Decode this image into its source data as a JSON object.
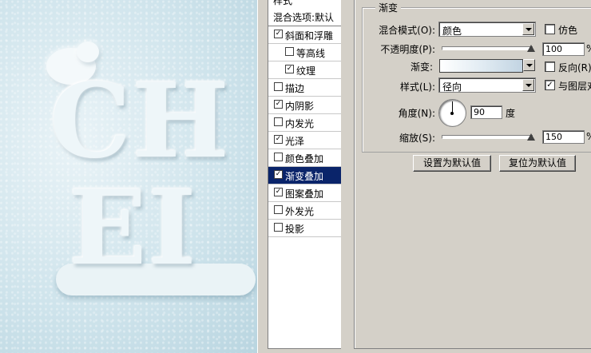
{
  "canvas": {
    "text_line1": "CH",
    "text_line2": "EI"
  },
  "styles_panel": {
    "clipped_header": "样式",
    "blending_options": "混合选项:默认",
    "items": [
      {
        "label": "斜面和浮雕",
        "checked": true,
        "indent": false,
        "selected": false
      },
      {
        "label": "等高线",
        "checked": false,
        "indent": true,
        "selected": false
      },
      {
        "label": "纹理",
        "checked": true,
        "indent": true,
        "selected": false
      },
      {
        "label": "描边",
        "checked": false,
        "indent": false,
        "selected": false
      },
      {
        "label": "内阴影",
        "checked": true,
        "indent": false,
        "selected": false
      },
      {
        "label": "内发光",
        "checked": false,
        "indent": false,
        "selected": false
      },
      {
        "label": "光泽",
        "checked": true,
        "indent": false,
        "selected": false
      },
      {
        "label": "颜色叠加",
        "checked": false,
        "indent": false,
        "selected": false
      },
      {
        "label": "渐变叠加",
        "checked": true,
        "indent": false,
        "selected": true
      },
      {
        "label": "图案叠加",
        "checked": true,
        "indent": false,
        "selected": false
      },
      {
        "label": "外发光",
        "checked": false,
        "indent": false,
        "selected": false
      },
      {
        "label": "投影",
        "checked": false,
        "indent": false,
        "selected": false
      }
    ]
  },
  "gradient_overlay": {
    "group_title": "渐变",
    "blend_mode_label": "混合模式(O):",
    "blend_mode_value": "颜色",
    "dither_label": "仿色",
    "dither_checked": false,
    "opacity_label": "不透明度(P):",
    "opacity_value": "100",
    "opacity_unit": "%",
    "opacity_fraction": 1.0,
    "gradient_label": "渐变:",
    "reverse_label": "反向(R)",
    "reverse_checked": false,
    "style_label": "样式(L):",
    "style_value": "径向",
    "align_label": "与图层对",
    "align_checked": true,
    "angle_label": "角度(N):",
    "angle_value": "90",
    "angle_unit": "度",
    "scale_label": "缩放(S):",
    "scale_value": "150",
    "scale_unit": "%",
    "scale_fraction": 1.0,
    "make_default_button": "设置为默认值",
    "reset_default_button": "复位为默认值"
  },
  "colors": {
    "selection": "#0a246a",
    "dialog_bg": "#d4d0c8"
  }
}
